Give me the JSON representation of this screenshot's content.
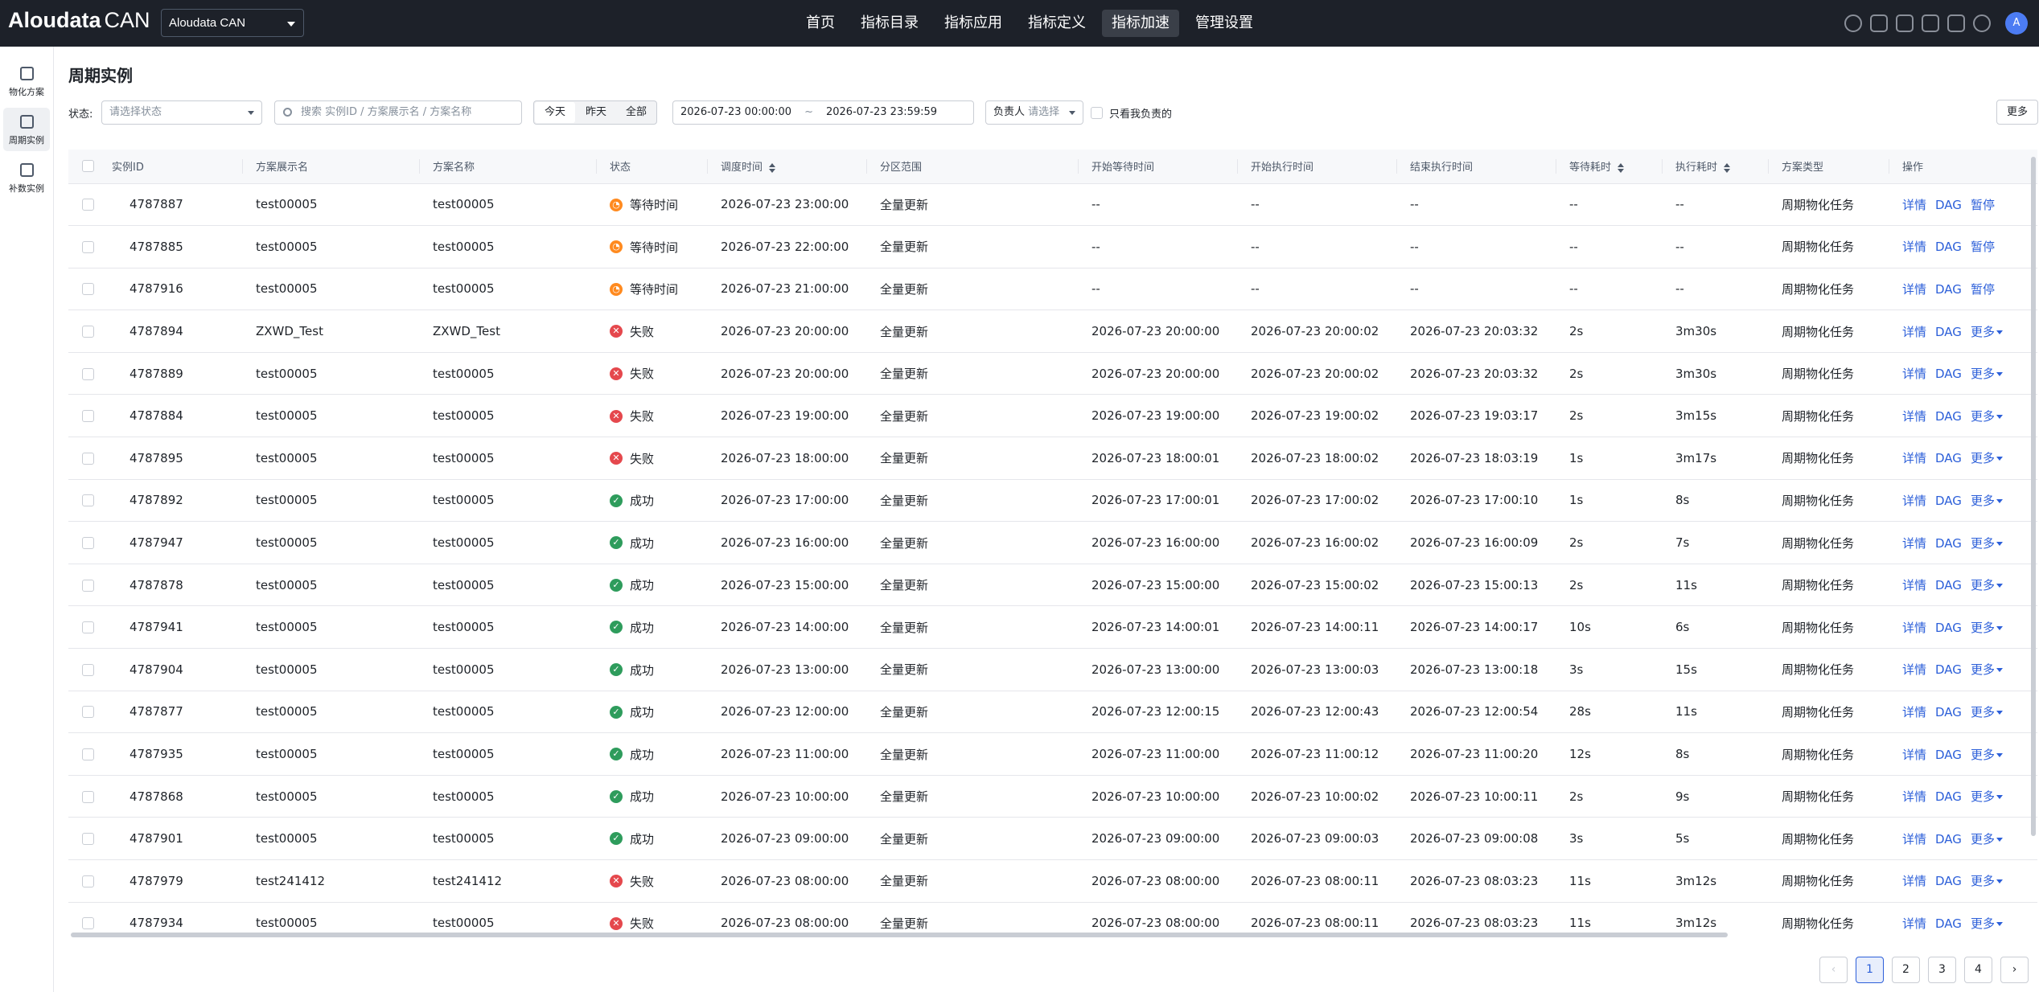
{
  "header": {
    "logo_main": "Aloudata",
    "logo_sub": "CAN",
    "workspace": "Aloudata CAN",
    "nav": [
      {
        "label": "首页",
        "active": false
      },
      {
        "label": "指标目录",
        "active": false
      },
      {
        "label": "指标应用",
        "active": false
      },
      {
        "label": "指标定义",
        "active": false
      },
      {
        "label": "指标加速",
        "active": true
      },
      {
        "label": "管理设置",
        "active": false
      }
    ],
    "icons": [
      "clock-icon",
      "upload-icon",
      "calendar-icon",
      "user-icon",
      "download-icon",
      "help-icon"
    ],
    "avatar": "A"
  },
  "sidebar": [
    {
      "label": "物化方案",
      "icon": "document-icon",
      "active": false
    },
    {
      "label": "周期实例",
      "icon": "schedule-icon",
      "active": true
    },
    {
      "label": "补数实例",
      "icon": "backfill-icon",
      "active": false
    }
  ],
  "page": {
    "title": "周期实例",
    "status_label": "状态:",
    "status_placeholder": "请选择状态",
    "search_placeholder": "搜索 实例ID / 方案展示名 / 方案名称",
    "date_tabs": [
      {
        "label": "今天",
        "active": true
      },
      {
        "label": "昨天",
        "active": false
      },
      {
        "label": "全部",
        "active": false
      }
    ],
    "date_start": "2026-07-23 00:00:00",
    "date_sep": "~",
    "date_end": "2026-07-23 23:59:59",
    "owner_label": "负责人",
    "owner_placeholder": "请选择",
    "only_mine": "只看我负责的",
    "more": "更多"
  },
  "table": {
    "columns": [
      "实例ID",
      "方案展示名",
      "方案名称",
      "状态",
      "调度时间",
      "分区范围",
      "开始等待时间",
      "开始执行时间",
      "结束执行时间",
      "等待耗时",
      "执行耗时",
      "方案类型",
      "操作"
    ],
    "rows": [
      [
        "4787887",
        "test00005",
        "test00005",
        "wait",
        "等待时间",
        "2026-07-23 23:00:00",
        "全量更新",
        "--",
        "--",
        "--",
        "--",
        "--",
        "周期物化任务",
        "pause"
      ],
      [
        "4787885",
        "test00005",
        "test00005",
        "wait",
        "等待时间",
        "2026-07-23 22:00:00",
        "全量更新",
        "--",
        "--",
        "--",
        "--",
        "--",
        "周期物化任务",
        "pause"
      ],
      [
        "4787916",
        "test00005",
        "test00005",
        "wait",
        "等待时间",
        "2026-07-23 21:00:00",
        "全量更新",
        "--",
        "--",
        "--",
        "--",
        "--",
        "周期物化任务",
        "pause"
      ],
      [
        "4787894",
        "ZXWD_Test",
        "ZXWD_Test",
        "fail",
        "失败",
        "2026-07-23 20:00:00",
        "全量更新",
        "2026-07-23 20:00:00",
        "2026-07-23 20:00:02",
        "2026-07-23 20:03:32",
        "2s",
        "3m30s",
        "周期物化任务",
        "more"
      ],
      [
        "4787889",
        "test00005",
        "test00005",
        "fail",
        "失败",
        "2026-07-23 20:00:00",
        "全量更新",
        "2026-07-23 20:00:00",
        "2026-07-23 20:00:02",
        "2026-07-23 20:03:32",
        "2s",
        "3m30s",
        "周期物化任务",
        "more"
      ],
      [
        "4787884",
        "test00005",
        "test00005",
        "fail",
        "失败",
        "2026-07-23 19:00:00",
        "全量更新",
        "2026-07-23 19:00:00",
        "2026-07-23 19:00:02",
        "2026-07-23 19:03:17",
        "2s",
        "3m15s",
        "周期物化任务",
        "more"
      ],
      [
        "4787895",
        "test00005",
        "test00005",
        "fail",
        "失败",
        "2026-07-23 18:00:00",
        "全量更新",
        "2026-07-23 18:00:01",
        "2026-07-23 18:00:02",
        "2026-07-23 18:03:19",
        "1s",
        "3m17s",
        "周期物化任务",
        "more"
      ],
      [
        "4787892",
        "test00005",
        "test00005",
        "ok",
        "成功",
        "2026-07-23 17:00:00",
        "全量更新",
        "2026-07-23 17:00:01",
        "2026-07-23 17:00:02",
        "2026-07-23 17:00:10",
        "1s",
        "8s",
        "周期物化任务",
        "more"
      ],
      [
        "4787947",
        "test00005",
        "test00005",
        "ok",
        "成功",
        "2026-07-23 16:00:00",
        "全量更新",
        "2026-07-23 16:00:00",
        "2026-07-23 16:00:02",
        "2026-07-23 16:00:09",
        "2s",
        "7s",
        "周期物化任务",
        "more"
      ],
      [
        "4787878",
        "test00005",
        "test00005",
        "ok",
        "成功",
        "2026-07-23 15:00:00",
        "全量更新",
        "2026-07-23 15:00:00",
        "2026-07-23 15:00:02",
        "2026-07-23 15:00:13",
        "2s",
        "11s",
        "周期物化任务",
        "more"
      ],
      [
        "4787941",
        "test00005",
        "test00005",
        "ok",
        "成功",
        "2026-07-23 14:00:00",
        "全量更新",
        "2026-07-23 14:00:01",
        "2026-07-23 14:00:11",
        "2026-07-23 14:00:17",
        "10s",
        "6s",
        "周期物化任务",
        "more"
      ],
      [
        "4787904",
        "test00005",
        "test00005",
        "ok",
        "成功",
        "2026-07-23 13:00:00",
        "全量更新",
        "2026-07-23 13:00:00",
        "2026-07-23 13:00:03",
        "2026-07-23 13:00:18",
        "3s",
        "15s",
        "周期物化任务",
        "more"
      ],
      [
        "4787877",
        "test00005",
        "test00005",
        "ok",
        "成功",
        "2026-07-23 12:00:00",
        "全量更新",
        "2026-07-23 12:00:15",
        "2026-07-23 12:00:43",
        "2026-07-23 12:00:54",
        "28s",
        "11s",
        "周期物化任务",
        "more"
      ],
      [
        "4787935",
        "test00005",
        "test00005",
        "ok",
        "成功",
        "2026-07-23 11:00:00",
        "全量更新",
        "2026-07-23 11:00:00",
        "2026-07-23 11:00:12",
        "2026-07-23 11:00:20",
        "12s",
        "8s",
        "周期物化任务",
        "more"
      ],
      [
        "4787868",
        "test00005",
        "test00005",
        "ok",
        "成功",
        "2026-07-23 10:00:00",
        "全量更新",
        "2026-07-23 10:00:00",
        "2026-07-23 10:00:02",
        "2026-07-23 10:00:11",
        "2s",
        "9s",
        "周期物化任务",
        "more"
      ],
      [
        "4787901",
        "test00005",
        "test00005",
        "ok",
        "成功",
        "2026-07-23 09:00:00",
        "全量更新",
        "2026-07-23 09:00:00",
        "2026-07-23 09:00:03",
        "2026-07-23 09:00:08",
        "3s",
        "5s",
        "周期物化任务",
        "more"
      ],
      [
        "4787979",
        "test241412",
        "test241412",
        "fail",
        "失败",
        "2026-07-23 08:00:00",
        "全量更新",
        "2026-07-23 08:00:00",
        "2026-07-23 08:00:11",
        "2026-07-23 08:03:23",
        "11s",
        "3m12s",
        "周期物化任务",
        "more"
      ],
      [
        "4787934",
        "test00005",
        "test00005",
        "fail",
        "失败",
        "2026-07-23 08:00:00",
        "全量更新",
        "2026-07-23 08:00:00",
        "2026-07-23 08:00:11",
        "2026-07-23 08:03:23",
        "11s",
        "3m12s",
        "周期物化任务",
        "more"
      ]
    ],
    "actions": {
      "detail": "详情",
      "dag": "DAG",
      "pause": "暂停",
      "more": "更多"
    }
  },
  "pagination": {
    "pages": [
      "1",
      "2",
      "3",
      "4"
    ],
    "current": "1",
    "prev": "‹",
    "next": "›"
  },
  "colors": {
    "topbar": "#1d2129",
    "link": "#2c5fd9",
    "wait": "#ff8a1f",
    "fail": "#e5484d",
    "ok": "#2e9c5c"
  }
}
